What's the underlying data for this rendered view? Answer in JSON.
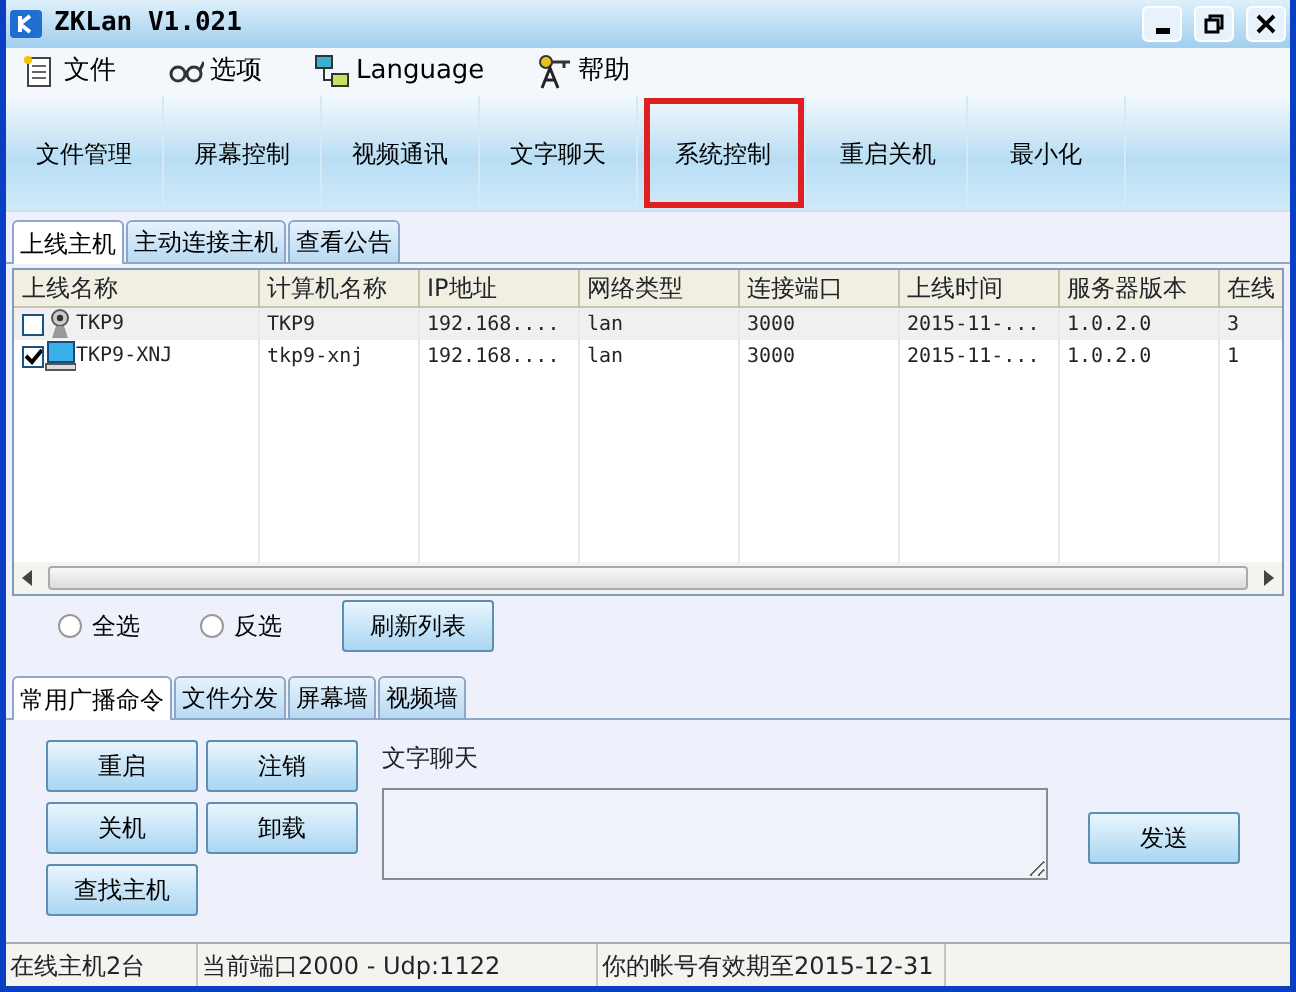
{
  "window": {
    "title": "ZKLan V1.021"
  },
  "menu": [
    {
      "label": "文件",
      "kind": "file"
    },
    {
      "label": "选项",
      "kind": "glasses"
    },
    {
      "label": "Language",
      "kind": "language"
    },
    {
      "label": "帮助",
      "kind": "help"
    }
  ],
  "toolbar": [
    {
      "label": "文件管理",
      "highlighted": false
    },
    {
      "label": "屏幕控制",
      "highlighted": false
    },
    {
      "label": "视频通讯",
      "highlighted": false
    },
    {
      "label": "文字聊天",
      "highlighted": false
    },
    {
      "label": "系统控制",
      "highlighted": true
    },
    {
      "label": "重启关机",
      "highlighted": false
    },
    {
      "label": "最小化",
      "highlighted": false
    }
  ],
  "tabs": [
    {
      "label": "上线主机",
      "selected": true
    },
    {
      "label": "主动连接主机",
      "selected": false
    },
    {
      "label": "查看公告",
      "selected": false
    }
  ],
  "table": {
    "columns": [
      "上线名称",
      "计算机名称",
      "IP地址",
      "网络类型",
      "连接端口",
      "上线时间",
      "服务器版本",
      "在线"
    ],
    "rows": [
      {
        "checked": false,
        "kind": "camera",
        "cells": [
          "TKP9",
          "TKP9",
          "192.168....",
          "lan",
          "3000",
          "2015-11-...",
          "1.0.2.0",
          "3"
        ]
      },
      {
        "checked": true,
        "kind": "monitor",
        "cells": [
          "TKP9-XNJ",
          "tkp9-xnj",
          "192.168....",
          "lan",
          "3000",
          "2015-11-...",
          "1.0.2.0",
          "1"
        ]
      }
    ]
  },
  "selection": [
    {
      "label": "全选",
      "checked": false
    },
    {
      "label": "反选",
      "checked": false
    }
  ],
  "refresh_button": "刷新列表",
  "sub_tabs": [
    {
      "label": "常用广播命令",
      "selected": true
    },
    {
      "label": "文件分发",
      "selected": false
    },
    {
      "label": "屏幕墙",
      "selected": false
    },
    {
      "label": "视频墙",
      "selected": false
    }
  ],
  "commands": [
    "重启",
    "注销",
    "关机",
    "卸载",
    "查找主机"
  ],
  "chat": {
    "label": "文字聊天",
    "send": "发送"
  },
  "status_bar": [
    "在线主机2台",
    "当前端口2000 - Udp:1122",
    "你的帐号有效期至2015-12-31"
  ]
}
